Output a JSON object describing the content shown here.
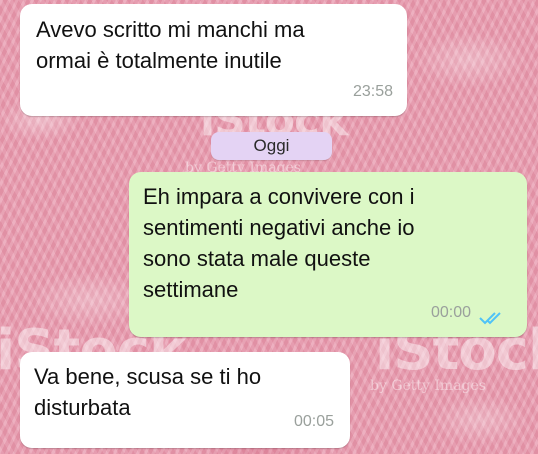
{
  "chat": {
    "date_separator": "Oggi",
    "messages": [
      {
        "direction": "incoming",
        "text": "Avevo scritto mi manchi ma\normai è totalmente inutile",
        "time": "23:58"
      },
      {
        "direction": "outgoing",
        "text": "Eh impara a convivere con i\nsentimenti negativi anche io\nsono stata male queste\nsettimane",
        "time": "00:00",
        "status": "read",
        "status_icon": "double-check-icon",
        "status_color": "#4fc3f7"
      },
      {
        "direction": "incoming",
        "text": "Va bene, scusa se ti ho\ndisturbata",
        "time": "00:05"
      }
    ]
  },
  "watermark": {
    "brand": "iStock",
    "sub": "by Getty Images"
  },
  "colors": {
    "background": "#e9a0b3",
    "incoming_bubble": "#ffffff",
    "outgoing_bubble": "#dcf8c6",
    "date_chip": "#e4d3f4"
  }
}
